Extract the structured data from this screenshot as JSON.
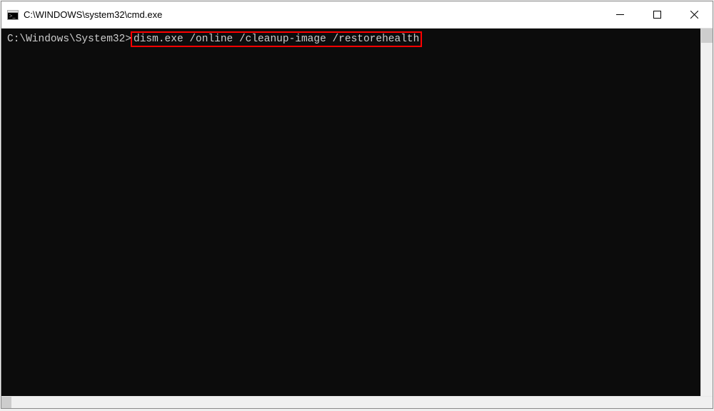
{
  "window": {
    "title": "C:\\WINDOWS\\system32\\cmd.exe"
  },
  "console": {
    "prompt": "C:\\Windows\\System32>",
    "command": "dism.exe /online /cleanup-image /restorehealth",
    "background_color": "#0c0c0c",
    "text_color": "#cccccc"
  },
  "annotation": {
    "highlight_color": "#ff0000"
  },
  "icons": {
    "app": "cmd-icon",
    "minimize": "minimize-icon",
    "maximize": "maximize-icon",
    "close": "close-icon"
  }
}
